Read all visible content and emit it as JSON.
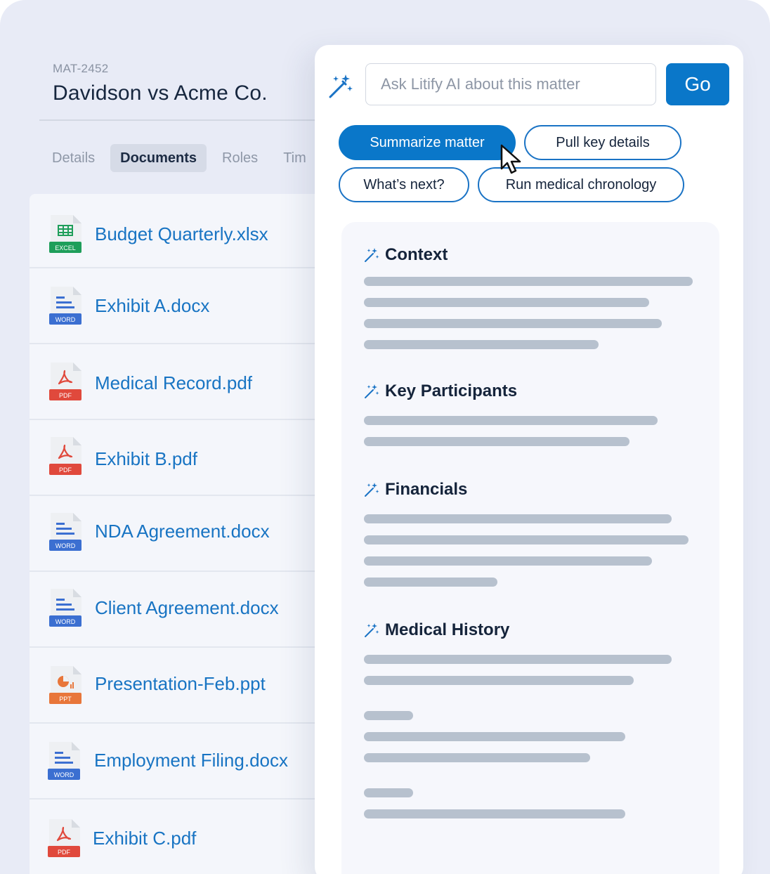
{
  "matter": {
    "id": "MAT-2452",
    "title": "Davidson vs Acme Co."
  },
  "tabs": [
    "Details",
    "Documents",
    "Roles",
    "Tim"
  ],
  "active_tab": "Documents",
  "documents": [
    {
      "name": "Budget Quarterly.xlsx",
      "type": "EXCEL",
      "icon": "excel-icon"
    },
    {
      "name": "Exhibit A.docx",
      "type": "WORD",
      "icon": "word-icon"
    },
    {
      "name": "Medical Record.pdf",
      "type": "PDF",
      "icon": "pdf-icon"
    },
    {
      "name": "Exhibit B.pdf",
      "type": "PDF",
      "icon": "pdf-icon"
    },
    {
      "name": "NDA Agreement.docx",
      "type": "WORD",
      "icon": "word-icon"
    },
    {
      "name": "Client Agreement.docx",
      "type": "WORD",
      "icon": "word-icon"
    },
    {
      "name": "Presentation-Feb.ppt",
      "type": "PPT",
      "icon": "ppt-icon"
    },
    {
      "name": "Employment Filing.docx",
      "type": "WORD",
      "icon": "word-icon"
    },
    {
      "name": "Exhibit C.pdf",
      "type": "PDF",
      "icon": "pdf-icon"
    }
  ],
  "ai": {
    "placeholder": "Ask Litify AI about this matter",
    "go_label": "Go",
    "chips": [
      "Summarize matter",
      "Pull key details",
      "What’s next?",
      "Run medical chronology"
    ],
    "active_chip": "Summarize matter",
    "sections": [
      "Context",
      "Key Participants",
      "Financials",
      "Medical History"
    ]
  },
  "colors": {
    "accent": "#0a77c9",
    "link": "#1874c3",
    "excel": "#1e9e5a",
    "word": "#3b6fd1",
    "pdf": "#e0493c",
    "ppt": "#e8763a",
    "skeleton": "#b7c1ce"
  }
}
